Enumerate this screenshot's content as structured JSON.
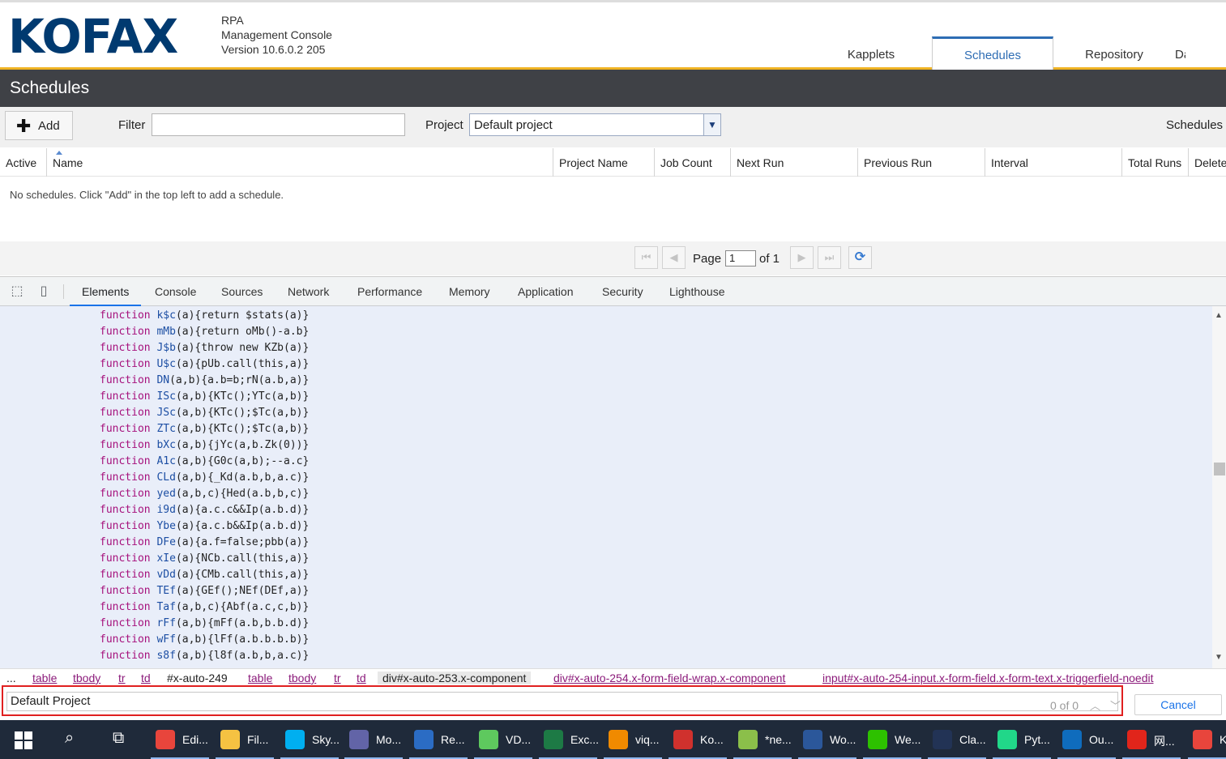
{
  "header": {
    "logo": "KOFAX",
    "product_line1": "RPA",
    "product_line2": "Management Console",
    "product_line3": "Version 10.6.0.2 205",
    "tabs": [
      {
        "label": "Kapplets"
      },
      {
        "label": "Schedules",
        "active": true
      },
      {
        "label": "Repository"
      },
      {
        "label": "Da"
      }
    ]
  },
  "page_title": "Schedules",
  "toolbar": {
    "add_label": "Add",
    "filter_label": "Filter",
    "filter_value": "",
    "project_label": "Project",
    "project_value": "Default project",
    "right_label": "Schedules p"
  },
  "grid": {
    "columns": [
      "Active",
      "Name",
      "Project Name",
      "Job Count",
      "Next Run",
      "Previous Run",
      "Interval",
      "Total Runs",
      "Delete"
    ],
    "empty_message": "No schedules. Click \"Add\" in the top left to add a schedule."
  },
  "paging": {
    "page_label": "Page",
    "page_value": "1",
    "of_label": "of 1"
  },
  "devtools": {
    "tabs": [
      "Elements",
      "Console",
      "Sources",
      "Network",
      "Performance",
      "Memory",
      "Application",
      "Security",
      "Lighthouse"
    ],
    "active_tab": "Elements",
    "code_lines": [
      {
        "name": "k$c",
        "params": "(a)",
        "body": "{return $stats(a)}"
      },
      {
        "name": "mMb",
        "params": "(a)",
        "body": "{return oMb()-a.b}"
      },
      {
        "name": "J$b",
        "params": "(a)",
        "body": "{throw new KZb(a)}"
      },
      {
        "name": "U$c",
        "params": "(a)",
        "body": "{pUb.call(this,a)}"
      },
      {
        "name": "DN",
        "params": "(a,b)",
        "body": "{a.b=b;rN(a.b,a)}"
      },
      {
        "name": "ISc",
        "params": "(a,b)",
        "body": "{KTc();YTc(a,b)}"
      },
      {
        "name": "JSc",
        "params": "(a,b)",
        "body": "{KTc();$Tc(a,b)}"
      },
      {
        "name": "ZTc",
        "params": "(a,b)",
        "body": "{KTc();$Tc(a,b)}"
      },
      {
        "name": "bXc",
        "params": "(a,b)",
        "body": "{jYc(a,b.Zk(0))}"
      },
      {
        "name": "A1c",
        "params": "(a,b)",
        "body": "{G0c(a,b);--a.c}"
      },
      {
        "name": "CLd",
        "params": "(a,b)",
        "body": "{_Kd(a.b,b,a.c)}"
      },
      {
        "name": "yed",
        "params": "(a,b,c)",
        "body": "{Hed(a.b,b,c)}"
      },
      {
        "name": "i9d",
        "params": "(a)",
        "body": "{a.c.c&&Ip(a.b.d)}"
      },
      {
        "name": "Ybe",
        "params": "(a)",
        "body": "{a.c.b&&Ip(a.b.d)}"
      },
      {
        "name": "DFe",
        "params": "(a)",
        "body": "{a.f=false;pbb(a)}"
      },
      {
        "name": "xIe",
        "params": "(a)",
        "body": "{NCb.call(this,a)}"
      },
      {
        "name": "vDd",
        "params": "(a)",
        "body": "{CMb.call(this,a)}"
      },
      {
        "name": "TEf",
        "params": "(a)",
        "body": "{GEf();NEf(DEf,a)}"
      },
      {
        "name": "Taf",
        "params": "(a,b,c)",
        "body": "{Abf(a.c,c,b)}"
      },
      {
        "name": "rFf",
        "params": "(a,b)",
        "body": "{mFf(a.b,b.b.d)}"
      },
      {
        "name": "wFf",
        "params": "(a,b)",
        "body": "{lFf(a.b.b.b.b)}"
      },
      {
        "name": "s8f",
        "params": "(a,b)",
        "body": "{l8f(a.b,b,a.c)}"
      }
    ],
    "keyword": "function",
    "breadcrumb": [
      "...",
      "table",
      "tbody",
      "tr",
      "td",
      "#x-auto-249",
      "table",
      "tbody",
      "tr",
      "td",
      "div#x-auto-253.x-component",
      "div#x-auto-254.x-form-field-wrap.x-component",
      "input#x-auto-254-input.x-form-field.x-form-text.x-triggerfield-noedit"
    ],
    "search_value": "Default Project",
    "match_count": "0 of 0",
    "cancel_label": "Cancel"
  },
  "taskbar": {
    "items": [
      {
        "label": "Edi...",
        "icon": "chrome-icon",
        "color": "#e8453c"
      },
      {
        "label": "Fil...",
        "icon": "folder-icon",
        "color": "#f5c242"
      },
      {
        "label": "Sky...",
        "icon": "skype-icon",
        "color": "#00aff0"
      },
      {
        "label": "Mo...",
        "icon": "teams-icon",
        "color": "#6264a7"
      },
      {
        "label": "Re...",
        "icon": "remote-desktop-icon",
        "color": "#2b6cc4"
      },
      {
        "label": "VD...",
        "icon": "cloud-icon",
        "color": "#5ec95e"
      },
      {
        "label": "Exc...",
        "icon": "excel-icon",
        "color": "#1d7a45"
      },
      {
        "label": "viq...",
        "icon": "search-magnifier-icon",
        "color": "#f08a00"
      },
      {
        "label": "Ko...",
        "icon": "pdf-icon",
        "color": "#d0312d"
      },
      {
        "label": "*ne...",
        "icon": "notepad-icon",
        "color": "#8bbf4a"
      },
      {
        "label": "Wo...",
        "icon": "word-icon",
        "color": "#2b579a"
      },
      {
        "label": "We...",
        "icon": "wechat-icon",
        "color": "#2dc100"
      },
      {
        "label": "Cla...",
        "icon": "cat-icon",
        "color": "#223355"
      },
      {
        "label": "Pyt...",
        "icon": "pycharm-icon",
        "color": "#21d789"
      },
      {
        "label": "Ou...",
        "icon": "outlook-icon",
        "color": "#0f6cbd"
      },
      {
        "label": "网...",
        "icon": "youdao-icon",
        "color": "#e1251b"
      },
      {
        "label": "K",
        "icon": "chrome-icon",
        "color": "#e8453c"
      }
    ]
  }
}
